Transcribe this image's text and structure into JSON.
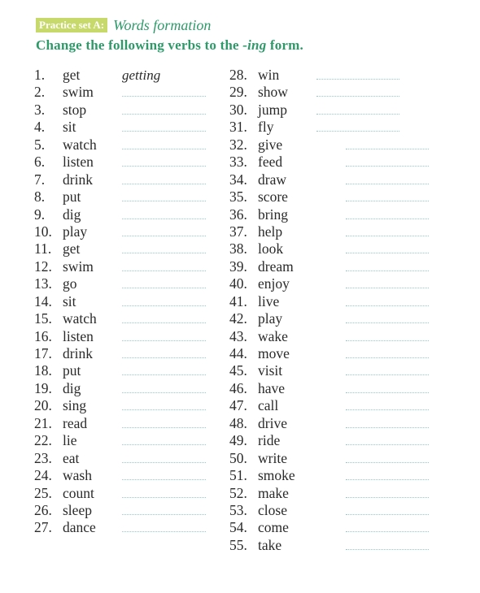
{
  "header": {
    "tag": "Practice set A:",
    "title": "Words formation",
    "instruction_before": "Change the following verbs to the ",
    "instruction_em": "-ing",
    "instruction_after": " form."
  },
  "colors": {
    "accent_green": "#2e9a6a",
    "tag_bg": "#c6d96a",
    "dotted_line": "#8fc7d6"
  },
  "left_items": [
    {
      "num": "1.",
      "verb": "get",
      "answer": "getting"
    },
    {
      "num": "2.",
      "verb": "swim",
      "answer": ""
    },
    {
      "num": "3.",
      "verb": "stop",
      "answer": ""
    },
    {
      "num": "4.",
      "verb": "sit",
      "answer": ""
    },
    {
      "num": "5.",
      "verb": "watch",
      "answer": ""
    },
    {
      "num": "6.",
      "verb": "listen",
      "answer": ""
    },
    {
      "num": "7.",
      "verb": "drink",
      "answer": ""
    },
    {
      "num": "8.",
      "verb": "put",
      "answer": ""
    },
    {
      "num": "9.",
      "verb": "dig",
      "answer": ""
    },
    {
      "num": "10.",
      "verb": "play",
      "answer": ""
    },
    {
      "num": "11.",
      "verb": "get",
      "answer": ""
    },
    {
      "num": "12.",
      "verb": "swim",
      "answer": ""
    },
    {
      "num": "13.",
      "verb": "go",
      "answer": ""
    },
    {
      "num": "14.",
      "verb": "sit",
      "answer": ""
    },
    {
      "num": "15.",
      "verb": "watch",
      "answer": ""
    },
    {
      "num": "16.",
      "verb": "listen",
      "answer": ""
    },
    {
      "num": "17.",
      "verb": "drink",
      "answer": ""
    },
    {
      "num": "18.",
      "verb": "put",
      "answer": ""
    },
    {
      "num": "19.",
      "verb": "dig",
      "answer": ""
    },
    {
      "num": "20.",
      "verb": "sing",
      "answer": ""
    },
    {
      "num": "21.",
      "verb": "read",
      "answer": ""
    },
    {
      "num": "22.",
      "verb": "lie",
      "answer": ""
    },
    {
      "num": "23.",
      "verb": "eat",
      "answer": ""
    },
    {
      "num": "24.",
      "verb": "wash",
      "answer": ""
    },
    {
      "num": "25.",
      "verb": "count",
      "answer": ""
    },
    {
      "num": "26.",
      "verb": "sleep",
      "answer": ""
    },
    {
      "num": "27.",
      "verb": "dance",
      "answer": ""
    }
  ],
  "right_items": [
    {
      "num": "28.",
      "verb": "win",
      "answer": ""
    },
    {
      "num": "29.",
      "verb": "show",
      "answer": ""
    },
    {
      "num": "30.",
      "verb": "jump",
      "answer": ""
    },
    {
      "num": "31.",
      "verb": "fly",
      "answer": ""
    },
    {
      "num": "32.",
      "verb": "give",
      "answer": ""
    },
    {
      "num": "33.",
      "verb": "feed",
      "answer": ""
    },
    {
      "num": "34.",
      "verb": "draw",
      "answer": ""
    },
    {
      "num": "35.",
      "verb": "score",
      "answer": ""
    },
    {
      "num": "36.",
      "verb": "bring",
      "answer": ""
    },
    {
      "num": "37.",
      "verb": "help",
      "answer": ""
    },
    {
      "num": "38.",
      "verb": "look",
      "answer": ""
    },
    {
      "num": "39.",
      "verb": "dream",
      "answer": ""
    },
    {
      "num": "40.",
      "verb": "enjoy",
      "answer": ""
    },
    {
      "num": "41.",
      "verb": "live",
      "answer": ""
    },
    {
      "num": "42.",
      "verb": "play",
      "answer": ""
    },
    {
      "num": "43.",
      "verb": "wake",
      "answer": ""
    },
    {
      "num": "44.",
      "verb": "move",
      "answer": ""
    },
    {
      "num": "45.",
      "verb": "visit",
      "answer": ""
    },
    {
      "num": "46.",
      "verb": "have",
      "answer": ""
    },
    {
      "num": "47.",
      "verb": "call",
      "answer": ""
    },
    {
      "num": "48.",
      "verb": "drive",
      "answer": ""
    },
    {
      "num": "49.",
      "verb": "ride",
      "answer": ""
    },
    {
      "num": "50.",
      "verb": "write",
      "answer": ""
    },
    {
      "num": "51.",
      "verb": "smoke",
      "answer": ""
    },
    {
      "num": "52.",
      "verb": "make",
      "answer": ""
    },
    {
      "num": "53.",
      "verb": "close",
      "answer": ""
    },
    {
      "num": "54.",
      "verb": "come",
      "answer": ""
    },
    {
      "num": "55.",
      "verb": "take",
      "answer": ""
    }
  ]
}
